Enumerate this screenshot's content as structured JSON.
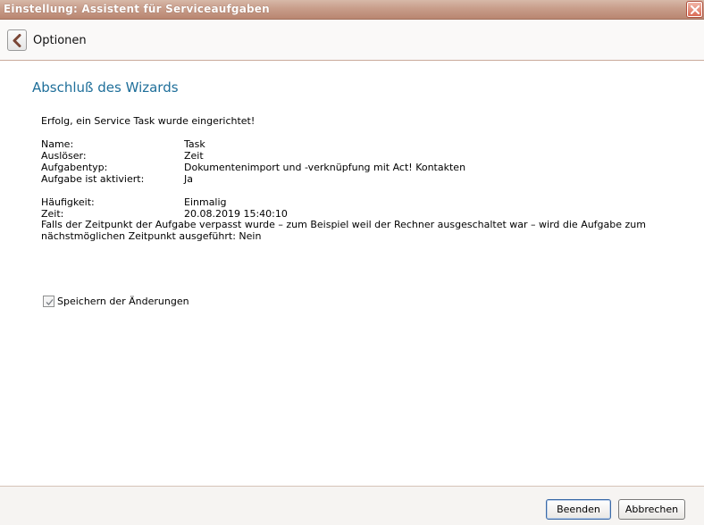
{
  "window": {
    "title": "Einstellung: Assistent für Serviceaufgaben",
    "close_icon": "close-icon"
  },
  "nav": {
    "back_icon": "chevron-left-icon",
    "label": "Optionen"
  },
  "main": {
    "heading": "Abschluß des Wizards",
    "success_message": "Erfolg, ein Service Task wurde eingerichtet!",
    "details": [
      {
        "label": "Name:",
        "value": "Task"
      },
      {
        "label": "Auslöser:",
        "value": "Zeit"
      },
      {
        "label": "Aufgabentyp:",
        "value": "Dokumentenimport und -verknüpfung mit Act! Kontakten"
      },
      {
        "label": "Aufgabe ist aktiviert:",
        "value": "Ja"
      }
    ],
    "schedule": [
      {
        "label": "Häufigkeit:",
        "value": "Einmalig"
      },
      {
        "label": "Zeit:",
        "value": "20.08.2019 15:40:10"
      }
    ],
    "note": "Falls der Zeitpunkt der Aufgabe verpasst wurde – zum Beispiel weil der Rechner ausgeschaltet war – wird die Aufgabe zum nächstmöglichen Zeitpunkt ausgeführt: Nein",
    "save_checkbox": {
      "label": "Speichern der Änderungen",
      "checked": true
    }
  },
  "footer": {
    "finish_label": "Beenden",
    "cancel_label": "Abbrechen"
  },
  "colors": {
    "heading": "#1f6f9a",
    "titlebar": "#c89d8a",
    "close_button": "#d96a55"
  }
}
